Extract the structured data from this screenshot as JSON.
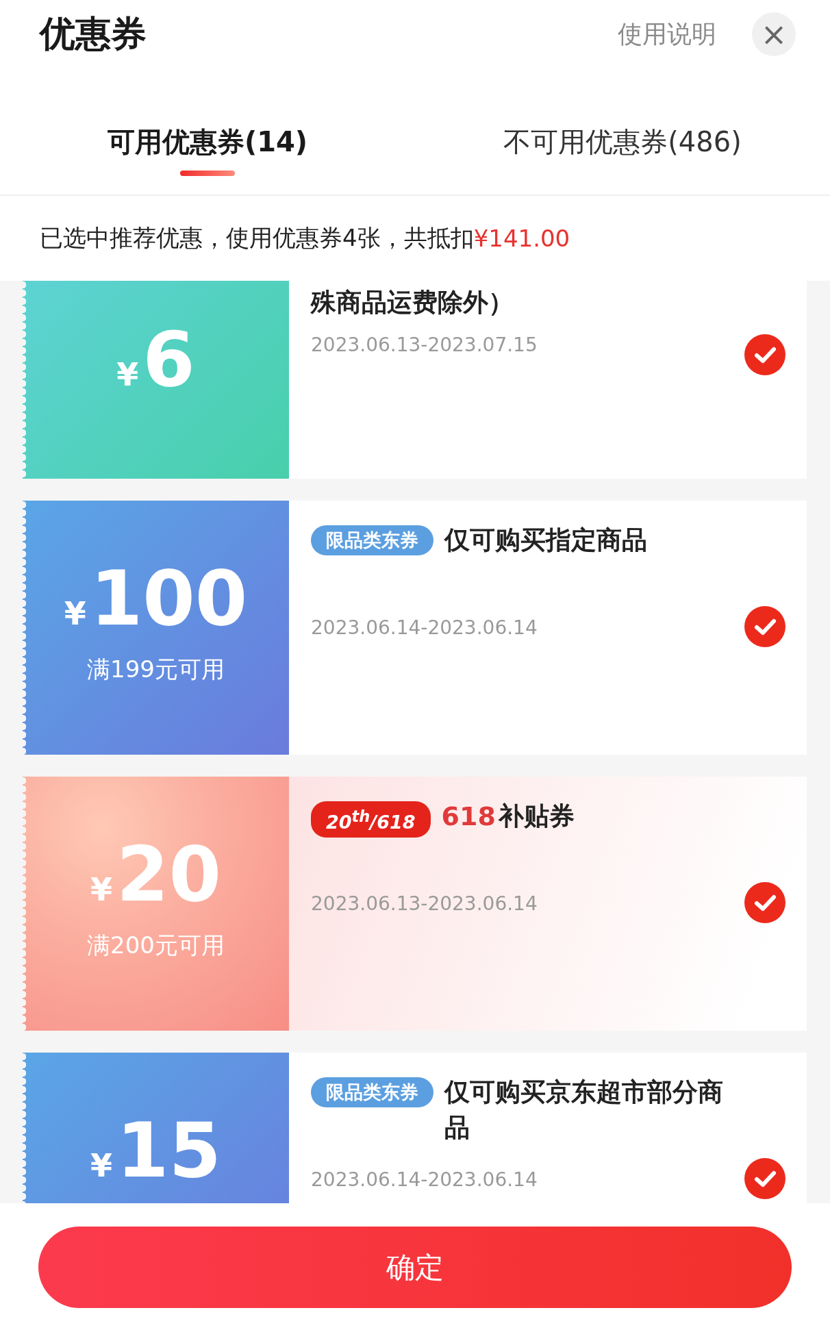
{
  "header": {
    "title": "优惠券",
    "help_link": "使用说明",
    "close": "×"
  },
  "tabs": [
    {
      "label": "可用优惠券(14)",
      "selected": true
    },
    {
      "label": "不可用优惠券(486)",
      "selected": false
    }
  ],
  "summary": {
    "text": "已选中推荐优惠，使用优惠券4张，共抵扣",
    "amount": "¥141.00"
  },
  "coupons": [
    {
      "kind": "teal",
      "currency": "¥",
      "amount": "6",
      "title": "殊商品运费除外）",
      "date": "2023.06.13-2023.07.15",
      "selected": true
    },
    {
      "kind": "blue",
      "currency": "¥",
      "amount": "100",
      "condition": "满199元可用",
      "badge": {
        "kind": "plain",
        "text": "限品类东券"
      },
      "title": "仅可购买指定商品",
      "date": "2023.06.14-2023.06.14",
      "selected": true
    },
    {
      "kind": "peach",
      "currency": "¥",
      "amount": "20",
      "condition": "满200元可用",
      "badge": {
        "kind": "event",
        "text": "20$^{th}$/618"
      },
      "highlight": "618",
      "title": "补贴券",
      "date": "2023.06.13-2023.06.14",
      "selected": true
    },
    {
      "kind": "blue",
      "currency": "¥",
      "amount": "15",
      "badge": {
        "kind": "plain",
        "text": "限品类东券"
      },
      "title": "仅可购买京东超市部分商品",
      "date": "2023.06.14-2023.06.14",
      "selected": true
    }
  ],
  "confirm_button": "确定"
}
